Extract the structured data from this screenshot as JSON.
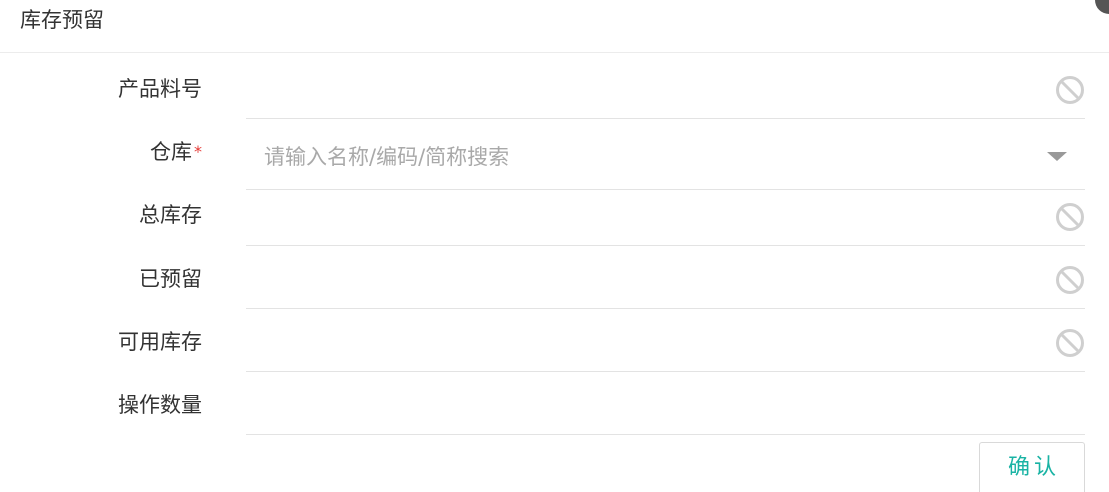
{
  "dialog": {
    "title": "库存预留"
  },
  "form": {
    "product_code": {
      "label": "产品料号",
      "value": "",
      "disabled": true
    },
    "warehouse": {
      "label": "仓库",
      "required_mark": "*",
      "placeholder": "请输入名称/编码/简称搜索",
      "value": ""
    },
    "total_stock": {
      "label": "总库存",
      "value": "",
      "disabled": true
    },
    "reserved": {
      "label": "已预留",
      "value": "",
      "disabled": true
    },
    "available_stock": {
      "label": "可用库存",
      "value": "",
      "disabled": true
    },
    "operation_quantity": {
      "label": "操作数量",
      "value": ""
    }
  },
  "actions": {
    "confirm_label": "确认"
  },
  "icons": {
    "disabled": "disabled-circle-slash-icon",
    "dropdown": "caret-down-icon"
  },
  "colors": {
    "accent": "#19b3a4",
    "required": "#e53935",
    "disabled_icon": "#cfcfcf"
  }
}
